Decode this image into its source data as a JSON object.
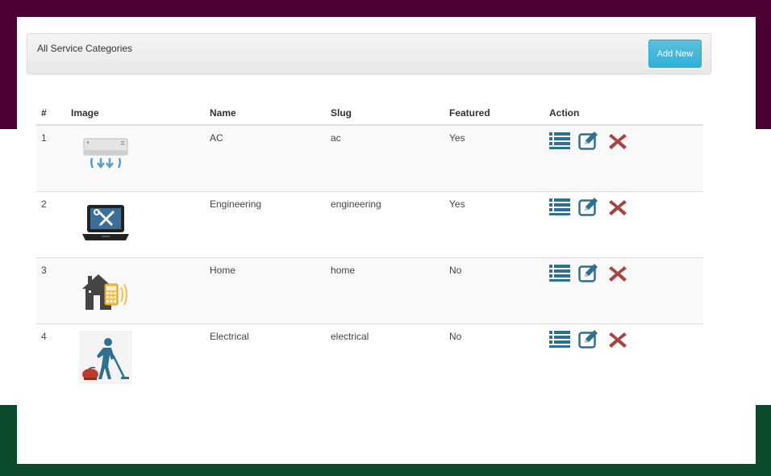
{
  "panel": {
    "title": "All Service Categories",
    "add_button": "Add New"
  },
  "table": {
    "headers": [
      "#",
      "Image",
      "Name",
      "Slug",
      "Featured",
      "Action"
    ],
    "rows": [
      {
        "num": "1",
        "image_icon": "air-conditioner-icon",
        "name": "AC",
        "slug": "ac",
        "featured": "Yes"
      },
      {
        "num": "2",
        "image_icon": "laptop-tools-icon",
        "name": "Engineering",
        "slug": "engineering",
        "featured": "Yes"
      },
      {
        "num": "3",
        "image_icon": "smart-home-icon",
        "name": "Home",
        "slug": "home",
        "featured": "No"
      },
      {
        "num": "4",
        "image_icon": "vacuum-cleaning-icon",
        "name": "Electrical",
        "slug": "electrical",
        "featured": "No"
      }
    ]
  },
  "colors": {
    "top_band": "#4a0033",
    "bottom_band": "#0c4a2c",
    "action_blue": "#2f6f8f",
    "delete_red": "#a94442",
    "button_blue": "#31b0d5"
  },
  "action_icons": [
    "list-icon",
    "edit-icon",
    "delete-icon"
  ]
}
